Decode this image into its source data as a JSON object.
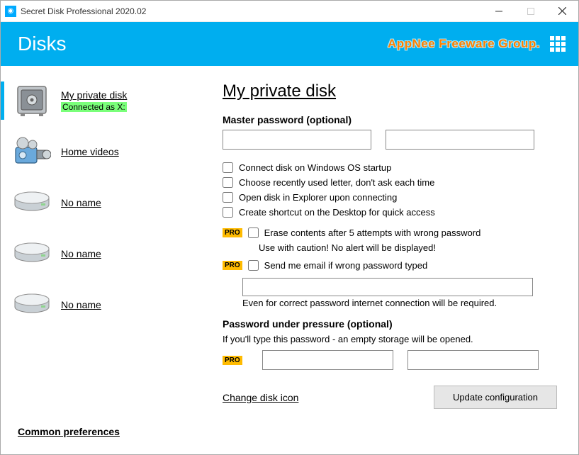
{
  "window": {
    "title": "Secret Disk Professional 2020.02"
  },
  "header": {
    "title": "Disks",
    "brand": "AppNee Freeware Group."
  },
  "sidebar": {
    "items": [
      {
        "name": "My private disk",
        "status": "Connected as X:",
        "icon": "safe"
      },
      {
        "name": "Home videos",
        "icon": "camcorder"
      },
      {
        "name": "No name",
        "icon": "drive"
      },
      {
        "name": "No name",
        "icon": "drive"
      },
      {
        "name": "No name",
        "icon": "drive"
      }
    ],
    "common_prefs": "Common preferences"
  },
  "main": {
    "title": "My private disk",
    "master_label": "Master password (optional)",
    "checks": {
      "c1": "Connect disk on Windows OS startup",
      "c2": "Choose recently used letter, don't ask each time",
      "c3": "Open disk in Explorer upon connecting",
      "c4": "Create shortcut on the Desktop for quick access",
      "c5": "Erase contents after 5 attempts with wrong password",
      "c5_hint": "Use with caution! No alert will be displayed!",
      "c6": "Send me email if wrong password typed",
      "c6_note": "Even for correct password internet connection will be required."
    },
    "pro_badge": "PRO",
    "pup_label": "Password under pressure (optional)",
    "pup_desc": "If you'll type this password - an empty storage will be opened.",
    "change_icon": "Change disk icon",
    "update_btn": "Update configuration"
  }
}
